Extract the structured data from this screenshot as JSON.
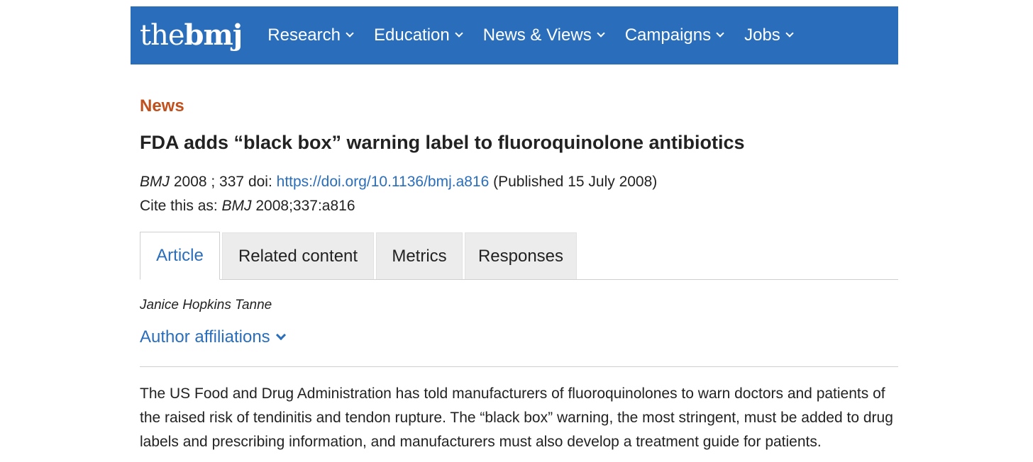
{
  "header": {
    "logo_light": "the",
    "logo_bold": "bmj",
    "nav": [
      {
        "label": "Research"
      },
      {
        "label": "Education"
      },
      {
        "label": "News & Views"
      },
      {
        "label": "Campaigns"
      },
      {
        "label": "Jobs"
      }
    ]
  },
  "article": {
    "section": "News",
    "title": "FDA adds “black box” warning label to fluoroquinolone antibiotics",
    "meta": {
      "journal": "BMJ",
      "year_volume": " 2008 ; 337 ",
      "doi_label": " doi: ",
      "doi_link": "https://doi.org/10.1136/bmj.a816",
      "published": " (Published 15 July 2008)"
    },
    "cite": {
      "prefix": "Cite this as: ",
      "journal": "BMJ",
      "ref": " 2008;337:a816"
    },
    "tabs": [
      {
        "label": "Article",
        "active": true
      },
      {
        "label": "Related content",
        "active": false
      },
      {
        "label": "Metrics",
        "active": false
      },
      {
        "label": "Responses",
        "active": false
      }
    ],
    "author": "Janice Hopkins Tanne",
    "affiliations_label": "Author affiliations",
    "body": "The US Food and Drug Administration has told manufacturers of fluoroquinolones to warn doctors and patients of the raised risk of tendinitis and tendon rupture. The “black box” warning, the most stringent, must be added to drug labels and prescribing information, and manufacturers must also develop a treatment guide for patients."
  },
  "colors": {
    "brand_blue": "#2a6ebb",
    "section_orange": "#c0501c",
    "tab_inactive": "#ececec"
  }
}
